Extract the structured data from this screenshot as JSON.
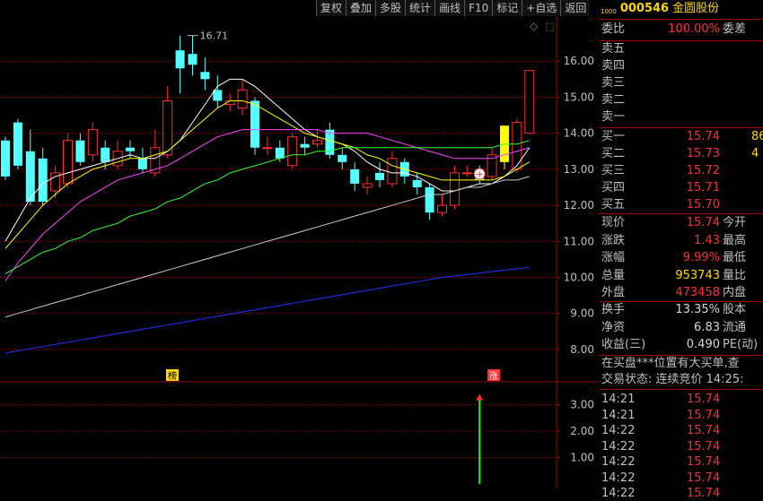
{
  "toolbar": [
    "复权",
    "叠加",
    "多股",
    "统计",
    "画线",
    "F10",
    "标记",
    "+自选",
    "返回"
  ],
  "colors": {
    "up": "#ff3030",
    "down": "#54ffff",
    "grid": "#a00000",
    "limit": "#ffff00",
    "bg": "#000000"
  },
  "chart_data": {
    "type": "candlestick",
    "ylim": [
      7.5,
      17.2
    ],
    "yticks": [
      "16.00",
      "15.00",
      "14.00",
      "13.00",
      "12.00",
      "11.00",
      "10.00",
      "9.00",
      "8.00"
    ],
    "ytick_values": [
      16,
      15,
      14,
      13,
      12,
      11,
      10,
      9,
      8
    ],
    "high_label": "16.71",
    "markers": {
      "rank": "榜",
      "limit_up": "涨"
    },
    "candles": [
      [
        13.8,
        12.8,
        13.9,
        12.7
      ],
      [
        14.3,
        13.1,
        14.4,
        13.0
      ],
      [
        13.5,
        12.1,
        14.1,
        12.0
      ],
      [
        13.3,
        12.1,
        13.6,
        12.0
      ],
      [
        12.4,
        12.9,
        13.1,
        12.2
      ],
      [
        12.6,
        13.8,
        14.0,
        12.5
      ],
      [
        13.8,
        13.2,
        14.0,
        13.1
      ],
      [
        13.4,
        14.1,
        14.3,
        13.2
      ],
      [
        13.6,
        13.2,
        13.8,
        13.0
      ],
      [
        13.1,
        13.5,
        13.8,
        13.0
      ],
      [
        13.6,
        13.5,
        13.8,
        13.3
      ],
      [
        13.3,
        13.0,
        13.6,
        12.9
      ],
      [
        12.9,
        13.6,
        14.1,
        12.8
      ],
      [
        13.4,
        14.9,
        15.3,
        13.3
      ],
      [
        16.3,
        15.8,
        16.71,
        15.1
      ],
      [
        16.2,
        15.9,
        16.71,
        15.6
      ],
      [
        15.7,
        15.5,
        16.1,
        15.2
      ],
      [
        15.2,
        14.9,
        15.6,
        14.7
      ],
      [
        14.8,
        14.9,
        15.1,
        14.6
      ],
      [
        14.7,
        15.2,
        15.5,
        14.5
      ],
      [
        14.9,
        13.6,
        15.0,
        13.4
      ],
      [
        13.6,
        13.6,
        13.9,
        13.4
      ],
      [
        13.6,
        13.3,
        13.8,
        13.2
      ],
      [
        13.1,
        13.9,
        14.0,
        13.0
      ],
      [
        13.7,
        13.6,
        13.9,
        13.4
      ],
      [
        13.7,
        13.8,
        14.1,
        13.6
      ],
      [
        14.1,
        13.4,
        14.3,
        13.3
      ],
      [
        13.4,
        13.2,
        13.6,
        13.0
      ],
      [
        13.0,
        12.6,
        13.2,
        12.4
      ],
      [
        12.5,
        12.6,
        12.8,
        12.3
      ],
      [
        12.9,
        12.7,
        13.2,
        12.5
      ],
      [
        12.6,
        13.3,
        13.5,
        12.5
      ],
      [
        13.2,
        12.8,
        13.3,
        12.6
      ],
      [
        12.7,
        12.5,
        12.9,
        12.3
      ],
      [
        12.5,
        11.8,
        12.6,
        11.6
      ],
      [
        11.8,
        12.0,
        12.3,
        11.7
      ],
      [
        12.0,
        12.9,
        13.1,
        11.9
      ],
      [
        12.9,
        12.9,
        13.1,
        12.8
      ],
      [
        12.9,
        12.7,
        13.1,
        12.6
      ],
      [
        12.8,
        13.4,
        13.6,
        12.7
      ],
      [
        14.21,
        13.2,
        14.21,
        13.0
      ],
      [
        13.0,
        14.3,
        14.4,
        12.9
      ],
      [
        14.0,
        15.74,
        15.74,
        14.0
      ]
    ],
    "ma_series": [
      {
        "color": "#ffffff",
        "values": [
          11.0,
          11.6,
          12.2,
          12.6,
          12.8,
          12.9,
          13.0,
          13.1,
          13.2,
          13.3,
          13.4,
          13.3,
          13.3,
          13.5,
          13.8,
          14.3,
          14.8,
          15.3,
          15.5,
          15.5,
          15.3,
          15.0,
          14.7,
          14.4,
          14.1,
          13.9,
          13.8,
          13.7,
          13.5,
          13.2,
          13.0,
          12.9,
          12.9,
          12.8,
          12.6,
          12.4,
          12.4,
          12.5,
          12.6,
          12.6,
          12.8,
          13.1,
          13.6
        ]
      },
      {
        "color": "#ffff00",
        "values": [
          10.8,
          11.2,
          11.6,
          12.0,
          12.3,
          12.6,
          12.8,
          13.0,
          13.1,
          13.2,
          13.3,
          13.3,
          13.4,
          13.5,
          13.8,
          14.1,
          14.4,
          14.7,
          14.9,
          14.9,
          14.8,
          14.6,
          14.4,
          14.2,
          14.0,
          13.9,
          13.8,
          13.7,
          13.6,
          13.4,
          13.3,
          13.1,
          13.0,
          12.9,
          12.8,
          12.7,
          12.7,
          12.7,
          12.7,
          12.7,
          12.8,
          13.0,
          13.2
        ]
      },
      {
        "color": "#ff44ff",
        "values": [
          9.9,
          10.4,
          10.8,
          11.2,
          11.5,
          11.8,
          12.1,
          12.3,
          12.5,
          12.7,
          12.8,
          12.9,
          13.0,
          13.1,
          13.3,
          13.5,
          13.7,
          13.9,
          14.0,
          14.1,
          14.1,
          14.1,
          14.1,
          14.1,
          14.1,
          14.1,
          14.0,
          14.0,
          14.0,
          14.0,
          13.9,
          13.8,
          13.7,
          13.6,
          13.5,
          13.4,
          13.3,
          13.3,
          13.3,
          13.3,
          13.4,
          13.5,
          13.6
        ]
      },
      {
        "color": "#33ff33",
        "values": [
          10.1,
          10.3,
          10.5,
          10.7,
          10.8,
          11.0,
          11.1,
          11.3,
          11.4,
          11.5,
          11.7,
          11.8,
          11.9,
          12.1,
          12.2,
          12.4,
          12.6,
          12.7,
          12.9,
          13.0,
          13.1,
          13.2,
          13.3,
          13.4,
          13.4,
          13.5,
          13.5,
          13.6,
          13.6,
          13.6,
          13.6,
          13.6,
          13.6,
          13.6,
          13.6,
          13.6,
          13.6,
          13.6,
          13.6,
          13.6,
          13.7,
          13.7,
          13.8
        ]
      },
      {
        "color": "#cccccc",
        "values": [
          8.9,
          9.0,
          9.1,
          9.2,
          9.3,
          9.4,
          9.5,
          9.6,
          9.7,
          9.8,
          9.9,
          10.0,
          10.1,
          10.2,
          10.3,
          10.4,
          10.5,
          10.6,
          10.7,
          10.8,
          10.9,
          11.0,
          11.1,
          11.2,
          11.3,
          11.4,
          11.5,
          11.6,
          11.7,
          11.8,
          11.9,
          12.0,
          12.1,
          12.2,
          12.3,
          12.3,
          12.4,
          12.5,
          12.5,
          12.6,
          12.7,
          12.7,
          12.8
        ]
      },
      {
        "color": "#2233ff",
        "values": [
          7.9,
          7.96,
          8.02,
          8.08,
          8.14,
          8.2,
          8.26,
          8.32,
          8.38,
          8.44,
          8.5,
          8.56,
          8.62,
          8.68,
          8.74,
          8.8,
          8.86,
          8.92,
          8.98,
          9.04,
          9.1,
          9.16,
          9.22,
          9.28,
          9.34,
          9.4,
          9.46,
          9.52,
          9.58,
          9.64,
          9.7,
          9.76,
          9.82,
          9.88,
          9.94,
          10.0,
          10.04,
          10.08,
          10.12,
          10.16,
          10.2,
          10.24,
          10.28
        ]
      }
    ],
    "sub": {
      "ylim": [
        0,
        3.8
      ],
      "yticks": [
        "3.00",
        "2.00",
        "1.00"
      ],
      "ytick_values": [
        3,
        2,
        1
      ],
      "signal_value": 3.4
    }
  },
  "quote": {
    "code": "000546",
    "name": "金圆股份",
    "sup": "1000",
    "weibi_label": "委比",
    "weibi": "100.00%",
    "weicha_label": "委差",
    "sells": [
      {
        "label": "卖五"
      },
      {
        "label": "卖四"
      },
      {
        "label": "卖三"
      },
      {
        "label": "卖二"
      },
      {
        "label": "卖一"
      }
    ],
    "buys": [
      {
        "label": "买一",
        "price": "15.74",
        "vol": "86"
      },
      {
        "label": "买二",
        "price": "15.73",
        "vol": "4"
      },
      {
        "label": "买三",
        "price": "15.72",
        "vol": ""
      },
      {
        "label": "买四",
        "price": "15.71",
        "vol": ""
      },
      {
        "label": "买五",
        "price": "15.70",
        "vol": ""
      }
    ],
    "stats1": [
      {
        "label": "现价",
        "value": "15.74",
        "color": "red",
        "l2": "今开"
      },
      {
        "label": "涨跌",
        "value": "1.43",
        "color": "red",
        "l2": "最高"
      },
      {
        "label": "涨幅",
        "value": "9.99%",
        "color": "red",
        "l2": "最低"
      },
      {
        "label": "总量",
        "value": "953743",
        "color": "yel",
        "l2": "量比"
      },
      {
        "label": "外盘",
        "value": "473458",
        "color": "red",
        "l2": "内盘"
      }
    ],
    "stats2": [
      {
        "label": "换手",
        "value": "13.35%",
        "color": "wht",
        "l2": "股本"
      },
      {
        "label": "净资",
        "value": "6.83",
        "color": "wht",
        "l2": "流通"
      },
      {
        "label": "收益(三)",
        "value": "0.490",
        "color": "wht",
        "l2": "PE(动)"
      }
    ],
    "msg1": "在买盘***位置有大买单,查",
    "msg2": "交易状态: 连续竞价 14:25:",
    "ticks": [
      {
        "time": "14:21",
        "price": "15.74"
      },
      {
        "time": "14:21",
        "price": "15.74"
      },
      {
        "time": "14:22",
        "price": "15.74"
      },
      {
        "time": "14:22",
        "price": "15.74"
      },
      {
        "time": "14:22",
        "price": "15.74"
      },
      {
        "time": "14:22",
        "price": "15.74"
      },
      {
        "time": "14:22",
        "price": "15.74"
      }
    ]
  }
}
